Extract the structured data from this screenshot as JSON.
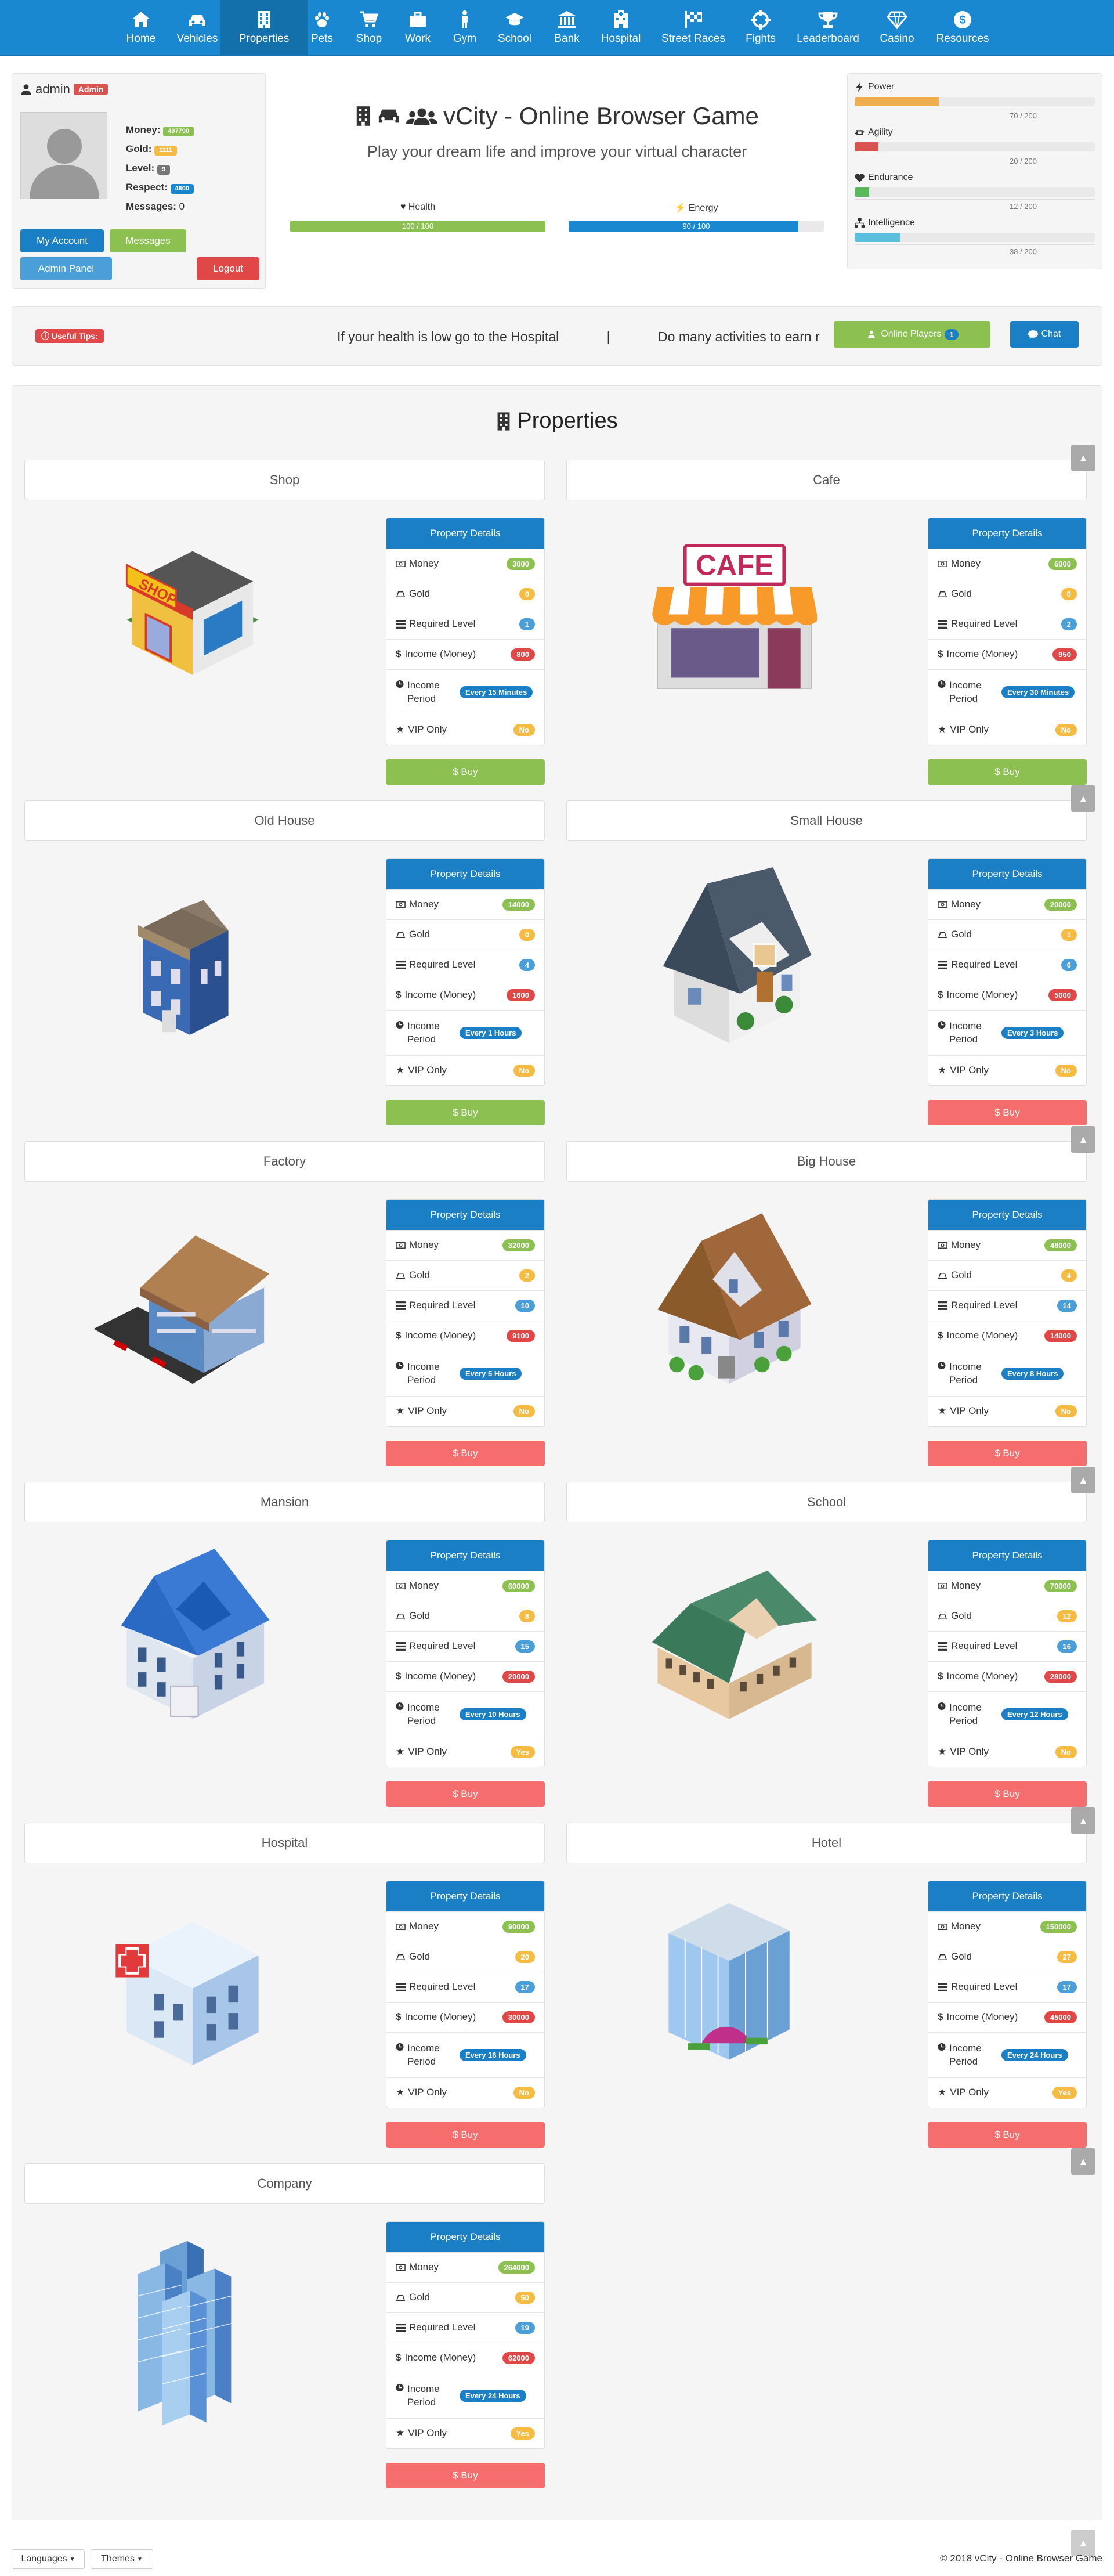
{
  "nav": {
    "items": [
      {
        "label": "Home",
        "icon": "home-icon"
      },
      {
        "label": "Vehicles",
        "icon": "car-icon"
      },
      {
        "label": "Properties",
        "icon": "building-icon"
      },
      {
        "label": "Pets",
        "icon": "paw-icon"
      },
      {
        "label": "Shop",
        "icon": "cart-icon"
      },
      {
        "label": "Work",
        "icon": "briefcase-icon"
      },
      {
        "label": "Gym",
        "icon": "male-icon"
      },
      {
        "label": "School",
        "icon": "graduation-cap-icon"
      },
      {
        "label": "Bank",
        "icon": "bank-icon"
      },
      {
        "label": "Hospital",
        "icon": "hospital-icon"
      },
      {
        "label": "Street Races",
        "icon": "checkered-flag-icon"
      },
      {
        "label": "Fights",
        "icon": "crosshairs-icon"
      },
      {
        "label": "Leaderboard",
        "icon": "trophy-icon"
      },
      {
        "label": "Casino",
        "icon": "diamond-icon"
      },
      {
        "label": "Resources",
        "icon": "dollar-icon"
      }
    ],
    "active": "Properties"
  },
  "user": {
    "name": "admin",
    "role_badge": "Admin",
    "money_label": "Money:",
    "money": "407790",
    "gold_label": "Gold:",
    "gold": "1111",
    "level_label": "Level:",
    "level": "9",
    "respect_label": "Respect:",
    "respect": "4800",
    "messages_label": "Messages:",
    "messages": "0",
    "my_account": "My Account",
    "messages_btn": "Messages",
    "admin_panel": "Admin Panel",
    "logout": "Logout"
  },
  "hero": {
    "title": "vCity - Online Browser Game",
    "subtitle": "Play your dream life and improve your virtual character",
    "health_label": "Health",
    "health_value": "100 / 100",
    "health_fraction": 1.0,
    "energy_label": "Energy",
    "energy_value": "90 / 100",
    "energy_fraction": 0.9
  },
  "stats": [
    {
      "label": "Power",
      "value": "70 / 200",
      "fraction": 0.35,
      "color": "#f0ad4e",
      "icon": "bolt-icon"
    },
    {
      "label": "Agility",
      "value": "20 / 200",
      "fraction": 0.1,
      "color": "#d9534f",
      "icon": "retweet-icon"
    },
    {
      "label": "Endurance",
      "value": "12 / 200",
      "fraction": 0.06,
      "color": "#5cb85c",
      "icon": "heartbeat-icon"
    },
    {
      "label": "Intelligence",
      "value": "38 / 200",
      "fraction": 0.19,
      "color": "#5bc0de",
      "icon": "sitemap-icon"
    }
  ],
  "tips": {
    "badge": "Useful Tips:",
    "tip1": "If your health is low go to the Hospital",
    "separator": "|",
    "tip2": "Do many activities to earn r",
    "online_players": "Online Players",
    "online_count": "1",
    "chat": "Chat"
  },
  "page": {
    "title": "Properties"
  },
  "details_labels": {
    "header": "Property Details",
    "money": "Money",
    "gold": "Gold",
    "level": "Required Level",
    "income": "Income (Money)",
    "period": "Income Period",
    "vip": "VIP Only",
    "buy": "$ Buy"
  },
  "properties": [
    {
      "name": "Shop",
      "money": "3000",
      "gold": "0",
      "level": "1",
      "income": "800",
      "period": "Every 15 Minutes",
      "vip": "No",
      "affordable": true
    },
    {
      "name": "Cafe",
      "money": "6000",
      "gold": "0",
      "level": "2",
      "income": "950",
      "period": "Every 30 Minutes",
      "vip": "No",
      "affordable": true
    },
    {
      "name": "Old House",
      "money": "14000",
      "gold": "0",
      "level": "4",
      "income": "1600",
      "period": "Every 1 Hours",
      "vip": "No",
      "affordable": true
    },
    {
      "name": "Small House",
      "money": "20000",
      "gold": "1",
      "level": "6",
      "income": "5000",
      "period": "Every 3 Hours",
      "vip": "No",
      "affordable": false
    },
    {
      "name": "Factory",
      "money": "32000",
      "gold": "2",
      "level": "10",
      "income": "9100",
      "period": "Every 5 Hours",
      "vip": "No",
      "affordable": false
    },
    {
      "name": "Big House",
      "money": "48000",
      "gold": "4",
      "level": "14",
      "income": "14000",
      "period": "Every 8 Hours",
      "vip": "No",
      "affordable": false
    },
    {
      "name": "Mansion",
      "money": "60000",
      "gold": "8",
      "level": "15",
      "income": "20000",
      "period": "Every 10 Hours",
      "vip": "Yes",
      "affordable": false
    },
    {
      "name": "School",
      "money": "70000",
      "gold": "12",
      "level": "16",
      "income": "28000",
      "period": "Every 12 Hours",
      "vip": "No",
      "affordable": false
    },
    {
      "name": "Hospital",
      "money": "90000",
      "gold": "20",
      "level": "17",
      "income": "30000",
      "period": "Every 16 Hours",
      "vip": "No",
      "affordable": false
    },
    {
      "name": "Hotel",
      "money": "150000",
      "gold": "27",
      "level": "17",
      "income": "45000",
      "period": "Every 24 Hours",
      "vip": "Yes",
      "affordable": false
    },
    {
      "name": "Company",
      "money": "264000",
      "gold": "50",
      "level": "19",
      "income": "62000",
      "period": "Every 24 Hours",
      "vip": "Yes",
      "affordable": false
    }
  ],
  "footer": {
    "languages": "Languages",
    "themes": "Themes",
    "copyright": "© 2018 vCity - Online Browser Game"
  },
  "colors": {
    "primary": "#1a88d0",
    "success": "#8cc152",
    "danger": "#f56d6d",
    "warning": "#f6bb42",
    "info": "#4a9fd9"
  }
}
